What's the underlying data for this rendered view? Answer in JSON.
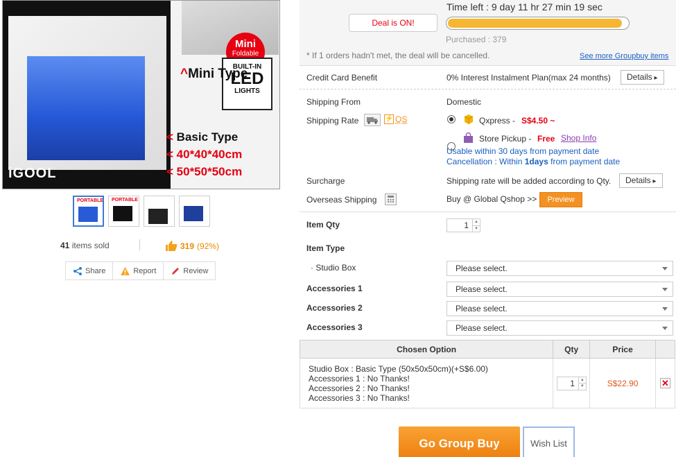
{
  "product": {
    "image_badge_mini": "Mini",
    "image_badge_foldable": "Foldable",
    "image_led_line1": "BUILT-IN",
    "image_led_line2": "LED",
    "image_led_line3": "LIGHTS",
    "image_mini_type": "Mini Type",
    "image_basic_type": "Basic Type",
    "image_size1": "40*40*40cm",
    "image_size2": "50*50*50cm",
    "image_logo": "iGOOL",
    "thumb_label": "PORTABLE",
    "items_sold_count": "41",
    "items_sold_text": "items sold",
    "likes": "319",
    "likes_pct": "(92%)",
    "actions": {
      "share": "Share",
      "report": "Report",
      "review": "Review"
    }
  },
  "deal": {
    "status_button": "Deal is ON!",
    "time_left": "Time left : 9 day 11 hr 27 min 19 sec",
    "progress_fraction": 0.97,
    "purchased": "Purchased : 379",
    "note": "* If 1 orders hadn't met, the deal will be cancelled.",
    "see_more_link": "See more Groupbuy items"
  },
  "credit": {
    "label": "Credit Card Benefit",
    "value": "0% Interest Instalment Plan(max 24 months)",
    "details": "Details"
  },
  "shipping": {
    "from_label": "Shipping From",
    "from_value": "Domestic",
    "rate_label": "Shipping Rate",
    "qs_label": "QS",
    "qxpress_label": "Qxpress -",
    "qxpress_price": "S$4.50 ~",
    "store_pickup_label": "Store Pickup -",
    "store_pickup_price": "Free",
    "shop_info_link": "Shop Info",
    "usable_note": "Usable within 30 days from payment date",
    "cancel_note_prefix": "Cancellation : Within",
    "cancel_note_days": "1days",
    "cancel_note_suffix": "from payment date"
  },
  "surcharge": {
    "label": "Surcharge",
    "value": "Shipping rate will be added according to Qty.",
    "details": "Details"
  },
  "overseas": {
    "label": "Overseas Shipping",
    "value": "Buy @ Global Qshop >>",
    "preview": "Preview"
  },
  "item_qty": {
    "label": "Item Qty",
    "value": "1"
  },
  "item_type": {
    "label": "Item Type",
    "sub_label": "· Studio Box",
    "placeholder": "Please select."
  },
  "accessories": [
    {
      "label": "Accessories 1",
      "placeholder": "Please select."
    },
    {
      "label": "Accessories 2",
      "placeholder": "Please select."
    },
    {
      "label": "Accessories 3",
      "placeholder": "Please select."
    }
  ],
  "chosen_table": {
    "headers": {
      "option": "Chosen Option",
      "qty": "Qty",
      "price": "Price"
    },
    "lines": [
      "Studio Box : Basic Type (50x50x50cm)(+S$6.00)",
      "Accessories 1 : No Thanks!",
      "Accessories 2 : No Thanks!",
      "Accessories 3 : No Thanks!"
    ],
    "qty": "1",
    "price": "S$22.90",
    "remove": "✕"
  },
  "buttons": {
    "go_group_buy": "Go Group Buy",
    "wish_list": "Wish List"
  },
  "colors": {
    "accent_orange": "#f39222",
    "price_red": "#e60012",
    "link_blue": "#1a5fbf",
    "progress": "#f5b733"
  }
}
